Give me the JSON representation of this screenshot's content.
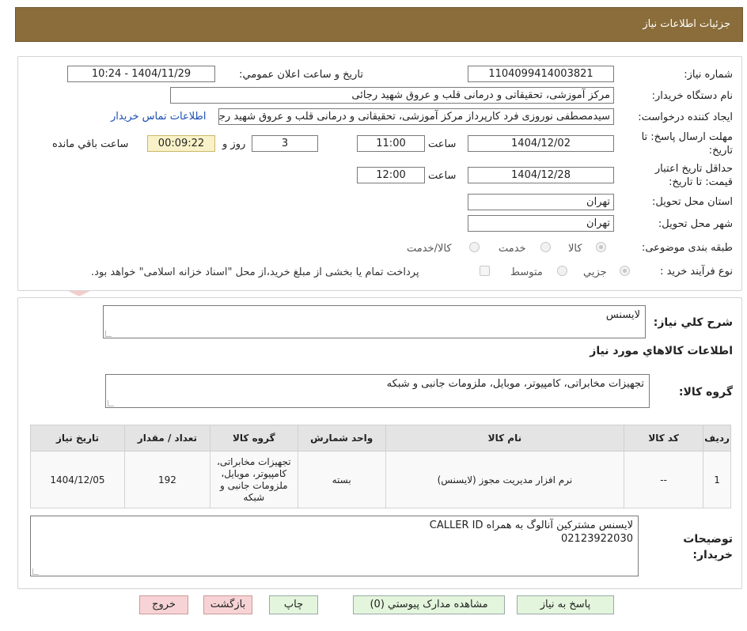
{
  "header": {
    "title": "جزئيات اطلاعات نياز"
  },
  "form": {
    "need_number_label": "شماره نياز:",
    "need_number": "1104099414003821",
    "announce_label": "تاريخ و ساعت اعلان عمومي:",
    "announce_value": "1404/11/29 - 10:24",
    "buyer_org_label": "نام دستگاه خريدار:",
    "buyer_org": "مرکز آموزشی، تحقیقاتی و درمانی قلب و عروق شهید رجائی",
    "requester_label": "ايجاد کننده درخواست:",
    "requester": "سیدمصطفی نوروزی فرد کارپرداز مرکز آموزشی، تحقیقاتی و درمانی قلب و عروق شهید رجائی",
    "contact_link": "اطلاعات تماس خريدار",
    "deadline_label": "مهلت ارسال پاسخ: تا تاريخ:",
    "deadline_date": "1404/12/02",
    "time_label": "ساعت",
    "deadline_time": "11:00",
    "days_value": "3",
    "days_label": "روز و",
    "remaining_time": "00:09:22",
    "remaining_label": "ساعت باقي مانده",
    "validity_label": "حداقل تاريخ اعتبار قيمت: تا تاريخ:",
    "validity_date": "1404/12/28",
    "validity_time_label": "ساعت",
    "validity_time": "12:00",
    "province_label": "استان محل تحويل:",
    "province": "تهران",
    "city_label": "شهر محل تحويل:",
    "city": "تهران",
    "category_label": "طبقه بندی موضوعی:",
    "category_options": [
      "کالا",
      "خدمت",
      "کالا/خدمت"
    ],
    "process_label": "نوع فرآيند خريد :",
    "process_options": [
      "جزيي",
      "متوسط"
    ],
    "payment_note": "پرداخت تمام يا بخشی از مبلغ خريد،از محل \"اسناد خزانه اسلامی\" خواهد بود."
  },
  "details": {
    "summary_label": "شرح کلي نياز:",
    "summary": "لايسنس",
    "goods_title": "اطلاعات کالاهاي مورد نياز",
    "group_label": "گروه کالا:",
    "group_value": "تجهیزات مخابراتی، کامپیوتر، موبایل، ملزومات جانبی و شبکه",
    "table": {
      "headers": [
        "رديف",
        "کد کالا",
        "نام کالا",
        "واحد شمارش",
        "گروه کالا",
        "تعداد / مقدار",
        "تاريخ نياز"
      ],
      "rows": [
        [
          "1",
          "--",
          "نرم افزار مدیریت مجوز (لایسنس)",
          "بسته",
          "تجهیزات مخابراتی، کامپیوتر، موبایل، ملزومات جانبی و شبکه",
          "192",
          "1404/12/05"
        ]
      ]
    },
    "buyer_notes_label": "توضيحات خريدار:",
    "buyer_notes_line1": "لایسنس مشترکین آنالوگ به همراه CALLER ID",
    "buyer_notes_line2": "02123922030"
  },
  "buttons": {
    "reply": "پاسخ به نياز",
    "attachments": "مشاهده مدارک پيوستي (0)",
    "print": "چاپ",
    "back": "بازگشت",
    "exit": "خروج"
  },
  "colors": {
    "header_bg": "#8a6d3b",
    "button_green": "#e3f5dc",
    "button_red": "#f7d3d6",
    "link": "#1a4fb5",
    "timer_bg": "#f9f2c8"
  }
}
